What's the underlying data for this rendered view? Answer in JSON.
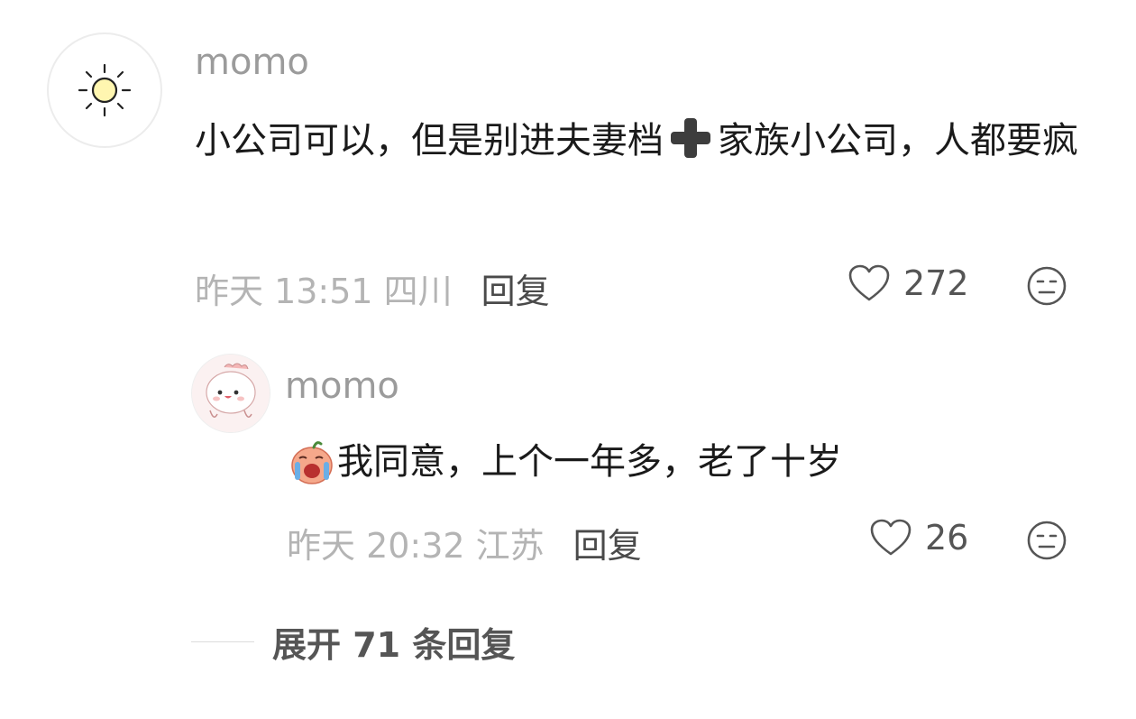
{
  "comment": {
    "username": "momo",
    "text_before": "小公司可以，但是别进夫妻档",
    "text_after": "家族小公司，人都要疯",
    "inline_emoji": "plus-emoji",
    "time": "昨天 13:51",
    "location": "四川",
    "reply_label": "回复",
    "like_count": "272"
  },
  "reply": {
    "username": "momo",
    "text": "我同意，上个一年多，老了十岁",
    "inline_emoji": "crying-pig-emoji",
    "time": "昨天 20:32",
    "location": "江苏",
    "reply_label": "回复",
    "like_count": "26"
  },
  "expand": {
    "label": "展开 71 条回复"
  },
  "colors": {
    "secondary_text": "#b4b4b4",
    "primary_text": "#1a1a1a",
    "username": "#9b9b9b"
  }
}
